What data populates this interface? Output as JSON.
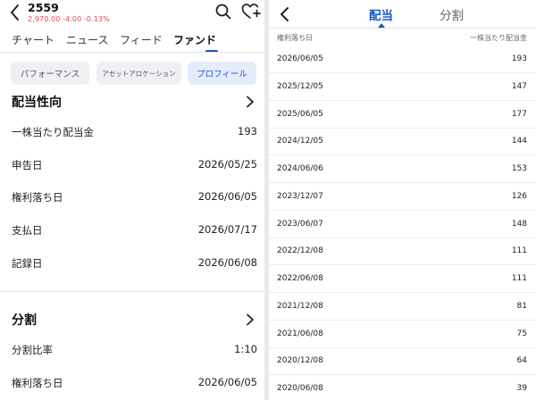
{
  "left": {
    "back_icon": "chevron-left-icon",
    "ticker": "2559",
    "quote": "2,970.00 -4.00 -0.13%",
    "quote_color": "#e0455a",
    "search_icon": "search-icon",
    "watchlist_icon": "heart-plus-icon",
    "tabs": [
      {
        "label": "チャート"
      },
      {
        "label": "ニュース"
      },
      {
        "label": "フィード"
      },
      {
        "label": "ファンド"
      }
    ],
    "active_tab": "ファンド",
    "segments": [
      {
        "label": "パフォーマンス"
      },
      {
        "label": "アセットアロケーション"
      },
      {
        "label": "プロフィール"
      }
    ],
    "active_segment": "プロフィール",
    "dividend_section": {
      "title": "配当性向",
      "rows": [
        {
          "label": "一株当たり配当金",
          "value": "193"
        },
        {
          "label": "申告日",
          "value": "2026/05/25"
        },
        {
          "label": "権利落ち日",
          "value": "2026/06/05"
        },
        {
          "label": "支払日",
          "value": "2026/07/17"
        },
        {
          "label": "記録日",
          "value": "2026/06/08"
        }
      ]
    },
    "split_section": {
      "title": "分割",
      "rows": [
        {
          "label": "分割比率",
          "value": "1:10"
        },
        {
          "label": "権利落ち日",
          "value": "2026/06/05"
        }
      ]
    }
  },
  "right": {
    "back_icon": "chevron-left-icon",
    "tabs": [
      {
        "label": "配当"
      },
      {
        "label": "分割"
      }
    ],
    "active_tab": "配当",
    "accent_color": "#1a56c8",
    "columns": {
      "date": "権利落ち日",
      "amount": "一株当たり配当金"
    },
    "rows": [
      {
        "date": "2026/06/05",
        "amount": "193"
      },
      {
        "date": "2025/12/05",
        "amount": "147"
      },
      {
        "date": "2025/06/05",
        "amount": "177"
      },
      {
        "date": "2024/12/05",
        "amount": "144"
      },
      {
        "date": "2024/06/06",
        "amount": "153"
      },
      {
        "date": "2023/12/07",
        "amount": "126"
      },
      {
        "date": "2023/06/07",
        "amount": "148"
      },
      {
        "date": "2022/12/08",
        "amount": "111"
      },
      {
        "date": "2022/06/08",
        "amount": "111"
      },
      {
        "date": "2021/12/08",
        "amount": "81"
      },
      {
        "date": "2021/06/08",
        "amount": "75"
      },
      {
        "date": "2020/12/08",
        "amount": "64"
      },
      {
        "date": "2020/06/08",
        "amount": "39"
      }
    ]
  }
}
